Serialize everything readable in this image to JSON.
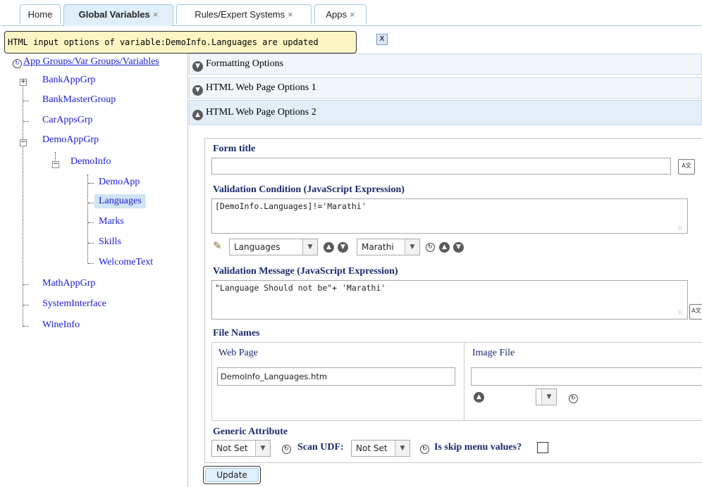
{
  "tabs": [
    {
      "label": "Home",
      "closable": false
    },
    {
      "label": "Global Variables",
      "closable": true
    },
    {
      "label": "Rules/Expert Systems",
      "closable": true
    },
    {
      "label": "Apps",
      "closable": true
    }
  ],
  "close_glyph": "×",
  "notification": {
    "message": "HTML input options of variable:DemoInfo.Languages are updated",
    "close": "X"
  },
  "tree": {
    "root": "App Groups/Var Groups/Variables",
    "groups": {
      "bank": "BankAppGrp",
      "bankmaster": "BankMasterGroup",
      "car": "CarAppsGrp",
      "demo": "DemoAppGrp",
      "math": "MathAppGrp",
      "system": "SystemInterface",
      "wine": "WineInfo"
    },
    "demoinfo": "DemoInfo",
    "variables": {
      "demoapp": "DemoApp",
      "languages": "Languages",
      "marks": "Marks",
      "skills": "Skills",
      "welcome": "WelcomeText"
    }
  },
  "accordion": {
    "formatting": "Formatting Options",
    "web1": "HTML Web Page Options 1",
    "web2": "HTML Web Page Options 2"
  },
  "form": {
    "form_title_label": "Form title",
    "form_title_value": "",
    "validation_condition_label": "Validation Condition (JavaScript Expression)",
    "validation_condition_value": "[DemoInfo.Languages]!='Marathi'",
    "var_select": "Languages",
    "value_select": "Marathi",
    "validation_message_label": "Validation Message (JavaScript Expression)",
    "validation_message_value": "\"Language Should not be\"+ 'Marathi'",
    "file_names_label": "File Names",
    "web_page_label": "Web Page",
    "web_page_value": "DemoInfo_Languages.htm",
    "image_file_label": "Image File",
    "image_file_value": "",
    "generic_attribute_label": "Generic Attribute",
    "generic_select": "Not Set",
    "scan_udf_label": "Scan UDF:",
    "scan_udf_select": "Not Set",
    "skip_menu_label": "Is skip menu values?",
    "skip_menu_checked": false,
    "update_label": "Update"
  }
}
